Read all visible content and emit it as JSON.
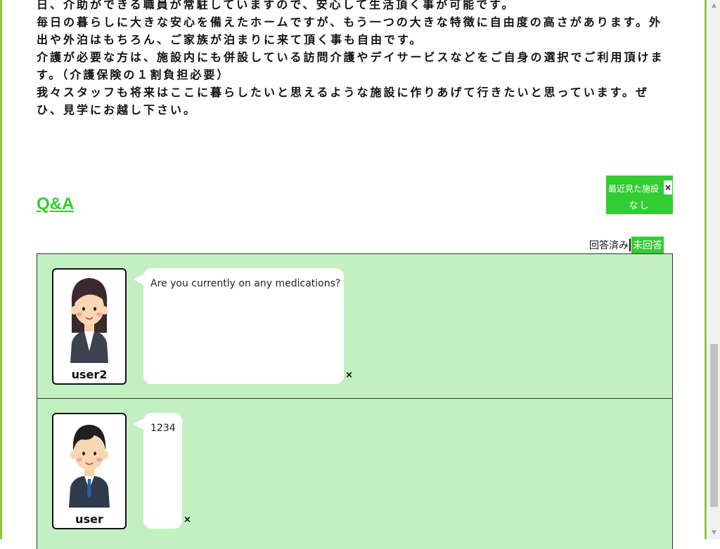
{
  "intro": {
    "lines": [
      "日、介助ができる職員が常駐していますので、安心して生活頂く事が可能です。",
      "毎日の暮らしに大きな安心を備えたホームですが、もう一つの大きな特徴に自由度の高さがあります。外出や外泊はもちろん、ご家族が泊まりに来て頂く事も自由です。",
      "介護が必要な方は、施設内にも併設している訪問介護やデイサービスなどをご自身の選択でご利用頂けます。（介護保険の１割負担必要）",
      "我々スタッフも将来はここに暮らしたいと思えるような施設に作りあげて行きたいと思っています。ぜひ、見学にお越し下さい。"
    ]
  },
  "qa": {
    "title": "Q&A",
    "filter": {
      "answered_label": "回答済み",
      "unanswered_label": "未回答"
    },
    "items": [
      {
        "user_name": "user2",
        "avatar_icon": "woman-avatar-icon",
        "message": "Are you currently on any medications?",
        "delete_label": "×"
      },
      {
        "user_name": "user",
        "avatar_icon": "man-avatar-icon",
        "message": "1234",
        "delete_label": "×"
      }
    ]
  },
  "recent": {
    "title": "最近見た施設",
    "close_label": "×",
    "empty_text": "なし"
  },
  "colors": {
    "accent_green": "#33cc33",
    "list_background": "#c2f0c2",
    "frame_green": "#8cc63f"
  }
}
